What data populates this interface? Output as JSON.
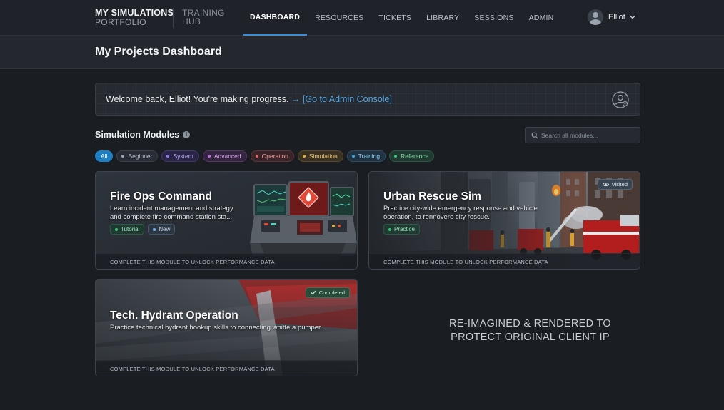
{
  "nav": {
    "brand_line1": "MY SIMULATIONS",
    "brand_line2": "PORTFOLIO",
    "brand2_line1": "TRAINING",
    "brand2_line2": "HUB",
    "items": [
      {
        "label": "DASHBOARD",
        "active": true
      },
      {
        "label": "RESOURCES",
        "active": false
      },
      {
        "label": "TICKETS",
        "active": false
      },
      {
        "label": "LIBRARY",
        "active": false
      },
      {
        "label": "SESSIONS",
        "active": false
      },
      {
        "label": "ADMIN",
        "active": false
      }
    ],
    "user_name": "Elliot"
  },
  "page": {
    "title": "My Projects Dashboard"
  },
  "welcome": {
    "message": "Welcome back, Elliot! You're making progress.",
    "link": "→ [Go to Admin Console]"
  },
  "modules": {
    "title": "Simulation Modules",
    "search_placeholder": "Search all modules...",
    "filters": [
      {
        "label": "All",
        "color": "#1e7fc2"
      },
      {
        "label": "Beginner",
        "color": "#9aa6b8"
      },
      {
        "label": "System",
        "color": "#8d7cf0"
      },
      {
        "label": "Advanced",
        "color": "#c070e0"
      },
      {
        "label": "Operation",
        "color": "#e06666"
      },
      {
        "label": "Simulation",
        "color": "#e0b040"
      },
      {
        "label": "Training",
        "color": "#40a8e0"
      },
      {
        "label": "Reference",
        "color": "#40c080"
      }
    ],
    "cards": [
      {
        "title": "Fire Ops Command",
        "desc_line1": "Learn incident management and strategy",
        "desc_line2": "and complete fire command station sta...",
        "tags": [
          "Tutorial",
          "New"
        ],
        "footer": "COMPLETE THIS MODULE TO UNLOCK PERFORMANCE DATA"
      },
      {
        "title": "Urban Rescue Sim",
        "desc_line1": "Practice city-wide emergency response and vehicle",
        "desc_line2": "operation, to rennovere city rescue.",
        "tags": [
          "Practice"
        ],
        "badge": "Visited",
        "footer": "COMPLETE THIS MODULE TO UNLOCK PERFORMANCE DATA"
      },
      {
        "title": "Tech. Hydrant Operation",
        "desc_line1": "Practice technical hydrant hookup skills to connecting whitte a pumper.",
        "badge": "Completed",
        "footer": "COMPLETE THIS MODULE TO UNLOCK PERFORMANCE DATA"
      }
    ]
  },
  "watermark": {
    "line1": "RE-IMAGINED & RENDERED TO",
    "line2": "PROTECT ORIGINAL CLIENT IP"
  },
  "colors": {
    "accent": "#3c8dd8",
    "link": "#5aa7e0",
    "background": "#1a1d22"
  }
}
